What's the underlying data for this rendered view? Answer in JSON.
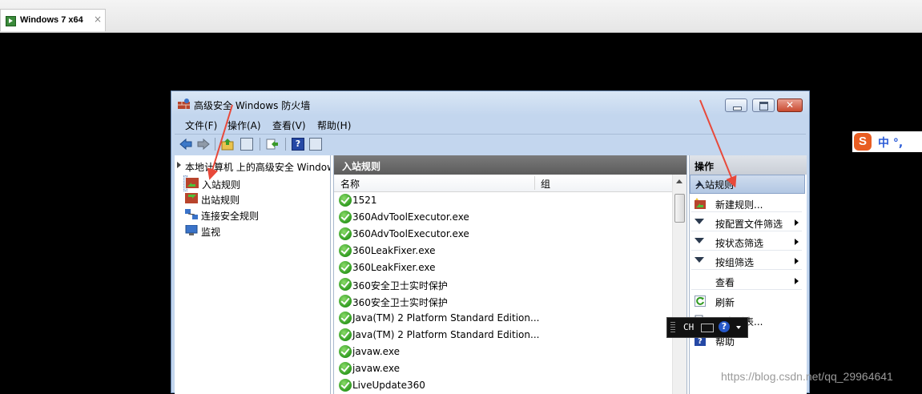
{
  "host": {
    "tab_title": "Windows 7 x64",
    "tab_close": "×"
  },
  "window": {
    "title": "高级安全 Windows 防火墙",
    "menu": [
      "文件(F)",
      "操作(A)",
      "查看(V)",
      "帮助(H)"
    ],
    "close_glyph": "✕"
  },
  "toolbar": {
    "help_glyph": "?"
  },
  "tree": {
    "root": "本地计算机 上的高级安全 Windows",
    "items": [
      {
        "label": "入站规则",
        "selected": true
      },
      {
        "label": "出站规则"
      },
      {
        "label": "连接安全规则"
      },
      {
        "label": "监视"
      }
    ]
  },
  "list": {
    "pane_title": "入站规则",
    "columns": [
      "名称",
      "组"
    ],
    "rows": [
      "1521",
      "360AdvToolExecutor.exe",
      "360AdvToolExecutor.exe",
      "360LeakFixer.exe",
      "360LeakFixer.exe",
      "360安全卫士实时保护",
      "360安全卫士实时保护",
      "Java(TM) 2 Platform Standard Edition...",
      "Java(TM) 2 Platform Standard Edition...",
      "javaw.exe",
      "javaw.exe",
      "LiveUpdate360"
    ]
  },
  "actions": {
    "pane_title": "操作",
    "section": "入站规则",
    "items": [
      {
        "label": "新建规则...",
        "icon": "new-rule-icon"
      },
      {
        "label": "按配置文件筛选",
        "icon": "filter-icon",
        "submenu": true
      },
      {
        "label": "按状态筛选",
        "icon": "filter-icon",
        "submenu": true
      },
      {
        "label": "按组筛选",
        "icon": "filter-icon",
        "submenu": true
      },
      {
        "label": "查看",
        "submenu": true
      },
      {
        "label": "刷新",
        "icon": "refresh-icon"
      },
      {
        "label": "导出列表...",
        "icon": "export-icon"
      },
      {
        "label": "帮助",
        "icon": "help-icon"
      }
    ]
  },
  "ime": {
    "text": "CH",
    "help": "?"
  },
  "sogou": {
    "logo": "S",
    "text": "中 °,"
  },
  "watermark": "https://blog.csdn.net/qq_29964641",
  "colors": {
    "arrow": "#e8493a",
    "accent": "#2f9a1f"
  }
}
